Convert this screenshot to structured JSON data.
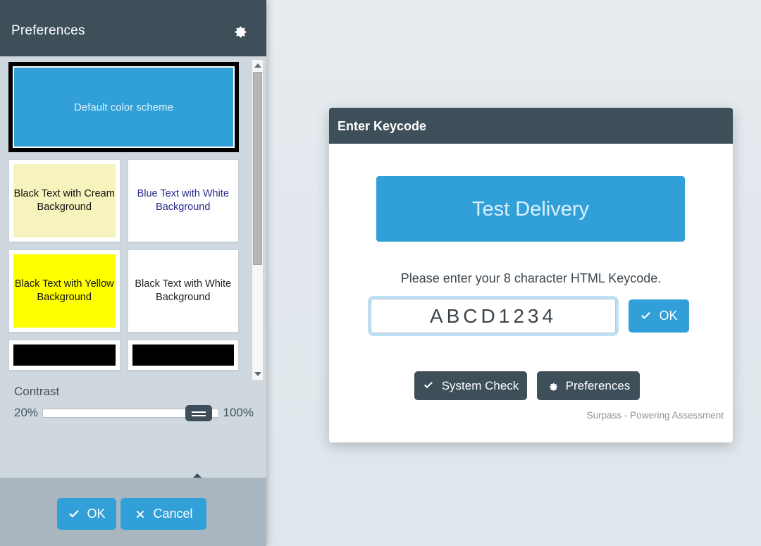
{
  "preferences_panel": {
    "title": "Preferences",
    "gear_icon": "gear-icon",
    "color_schemes": [
      {
        "label": "Default color scheme",
        "bg": "#32a0d8",
        "fg": "#d9f0fb",
        "selected": true,
        "span": "wide"
      },
      {
        "label": "Black Text with Cream Background",
        "bg": "#f6f3bc",
        "fg": "#111111",
        "selected": false,
        "span": "half"
      },
      {
        "label": "Blue Text with White Background",
        "bg": "#ffffff",
        "fg": "#2b2b8f",
        "selected": false,
        "span": "half"
      },
      {
        "label": "Black Text with Yellow Background",
        "bg": "#ffff00",
        "fg": "#111111",
        "selected": false,
        "span": "half"
      },
      {
        "label": "Black Text with White Background",
        "bg": "#ffffff",
        "fg": "#222222",
        "selected": false,
        "span": "half"
      },
      {
        "label": "",
        "bg": "#000000",
        "fg": "#ffffff",
        "selected": false,
        "span": "half-short"
      },
      {
        "label": "",
        "bg": "#000000",
        "fg": "#ffffff",
        "selected": false,
        "span": "half-short"
      }
    ],
    "contrast": {
      "label": "Contrast",
      "min_label": "20%",
      "max_label": "100%",
      "value_tooltip": "100%",
      "value": 100,
      "min": 20,
      "max": 100
    },
    "footer": {
      "ok_label": "OK",
      "ok_icon": "check-icon",
      "cancel_label": "Cancel",
      "cancel_icon": "cross-icon"
    },
    "scrollbar": {
      "up_icon": "chevron-up-icon",
      "down_icon": "chevron-down-icon"
    }
  },
  "keycode_dialog": {
    "title": "Enter Keycode",
    "banner_label": "Test Delivery",
    "instruction": "Please enter your 8 character HTML Keycode.",
    "input_value": "ABCD1234",
    "input_placeholder": "",
    "ok_label": "OK",
    "ok_icon": "check-icon",
    "system_check_label": "System Check",
    "system_check_icon": "check-icon",
    "preferences_label": "Preferences",
    "preferences_icon": "gear-icon",
    "footer_text": "Surpass - Powering Assessment"
  },
  "colors": {
    "dark": "#3e4f5a",
    "accent": "#32a0d8",
    "panel_bg": "#cfd8de",
    "panel_footer_bg": "#a9b6bf",
    "page_bg": "#e2e8ed"
  }
}
